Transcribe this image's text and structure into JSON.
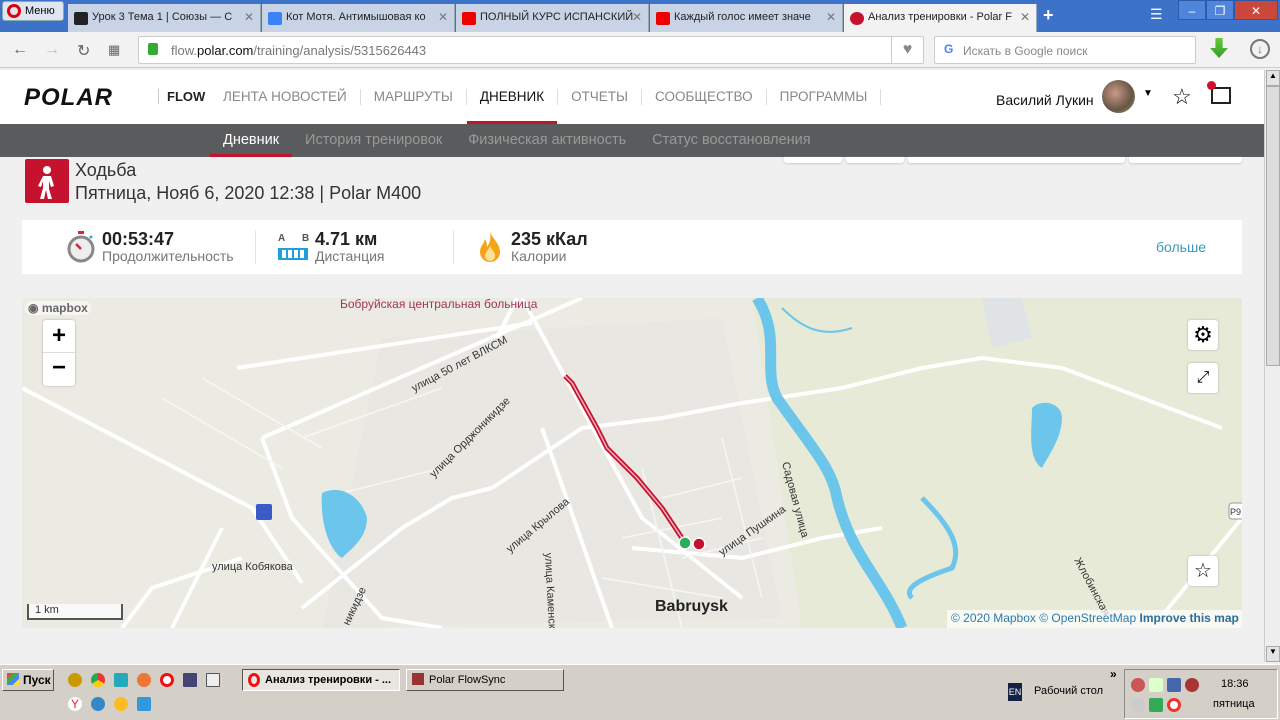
{
  "browser": {
    "menu_label": "Меню",
    "tabs": [
      {
        "title": "Урок 3 Тема 1 | Союзы — С",
        "icon": "lingualeo-icon",
        "color": "#222"
      },
      {
        "title": "Кот Мотя. Антимышовая ко",
        "icon": "video-play-icon",
        "color": "#3b82f6"
      },
      {
        "title": "ПОЛНЫЙ КУРС ИСПАНСКИЙ",
        "icon": "youtube-icon",
        "color": "#e00"
      },
      {
        "title": "Каждый голос имеет значе",
        "icon": "youtube-icon",
        "color": "#e00"
      },
      {
        "title": "Анализ тренировки - Polar F",
        "icon": "polar-tab-icon",
        "color": "#c4122f",
        "active": true
      }
    ],
    "url_prefix": "flow.",
    "url_domain": "polar.com",
    "url_path": "/training/analysis/5315626443",
    "search_placeholder": "Искать в Google поиск"
  },
  "header": {
    "logo": "POLAR",
    "flow": "FLOW",
    "nav": [
      "ЛЕНТА НОВОСТЕЙ",
      "МАРШРУТЫ",
      "ДНЕВНИК",
      "ОТЧЕТЫ",
      "СООБЩЕСТВО",
      "ПРОГРАММЫ"
    ],
    "active_nav": 2,
    "user_name": "Василий Лукин"
  },
  "subnav": {
    "items": [
      "Дневник",
      "История тренировок",
      "Физическая активность",
      "Статус восстановления"
    ],
    "active": 0
  },
  "training": {
    "sport": "Ходьба",
    "subtitle": "Пятница, Нояб 6, 2020 12:38 | Polar M400",
    "duration": "00:53:47",
    "duration_label": "Продолжительность",
    "distance": "4.71 км",
    "distance_label": "Дистанция",
    "dist_a": "A",
    "dist_b": "B",
    "calories": "235 кКал",
    "calories_label": "Калории",
    "more": "больше"
  },
  "map": {
    "mapbox_logo": "mapbox",
    "zoom_in": "+",
    "zoom_out": "−",
    "scale": "1 km",
    "labels": {
      "hospital": "Бобруйская центральная больница",
      "vlksm": "улица 50 лет ВЛКСМ",
      "ordzh": "улица Орджоникидзе",
      "ordzh2": "никидзе",
      "krylova": "улица Крылова",
      "kamenskaya": "улица Каменско",
      "kobyakova": "улица Кобякова",
      "pushkina": "улица Пушкина",
      "sadovaya": "Садовая улица",
      "zhlobinskaya": "Жлобинская",
      "city": "Babruysk",
      "road": "Р9"
    },
    "attrib_mapbox": "© 2020 Mapbox",
    "attrib_osm": "© OpenStreetMap",
    "attrib_improve": "Improve this map"
  },
  "taskbar": {
    "start": "Пуск",
    "windows": [
      {
        "label": "Анализ тренировки - ...",
        "active": true
      },
      {
        "label": "Polar FlowSync",
        "active": false
      }
    ],
    "lang": "EN",
    "desktop": "Рабочий стол",
    "time": "18:36",
    "day": "пятница"
  }
}
